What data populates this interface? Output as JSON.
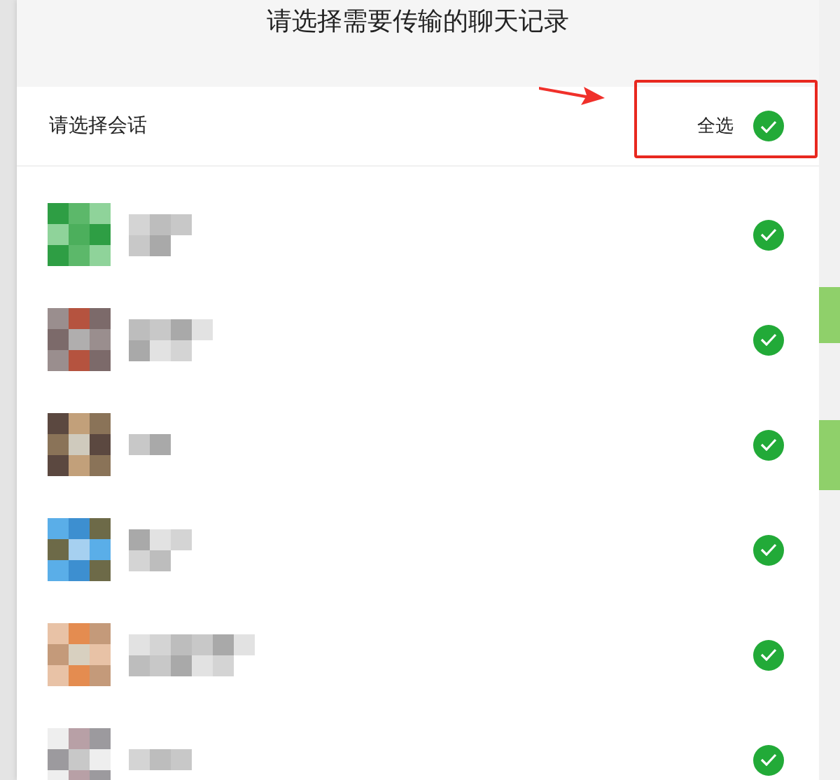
{
  "dialog": {
    "title": "请选择需要传输的聊天记录"
  },
  "header": {
    "label": "请选择会话",
    "select_all": {
      "label": "全选",
      "selected": true
    }
  },
  "conversations": [
    {
      "selected": true
    },
    {
      "selected": true
    },
    {
      "selected": true
    },
    {
      "selected": true
    },
    {
      "selected": true
    },
    {
      "selected": true
    }
  ]
}
